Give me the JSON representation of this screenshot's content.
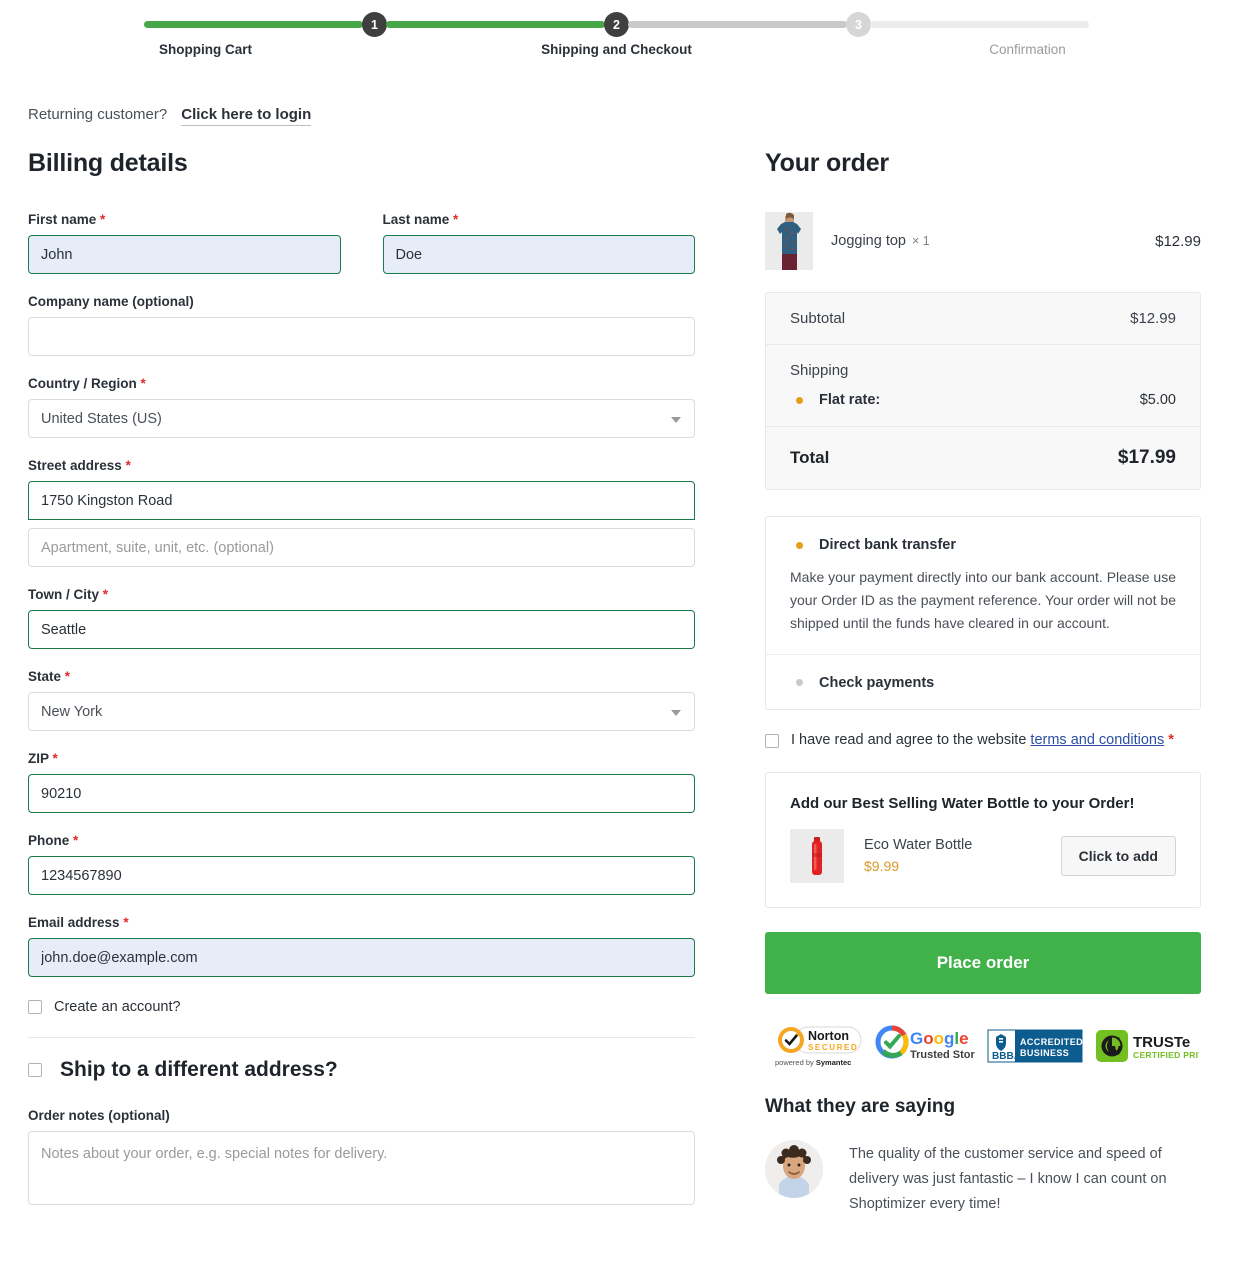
{
  "stepper": {
    "steps": [
      {
        "number": "1",
        "label": "Shopping Cart",
        "state": "active"
      },
      {
        "number": "2",
        "label": "Shipping and Checkout",
        "state": "active"
      },
      {
        "number": "3",
        "label": "Confirmation",
        "state": "inactive"
      }
    ]
  },
  "returning": {
    "prompt": "Returning customer?",
    "login_link": "Click here to login"
  },
  "billing": {
    "title": "Billing details",
    "first_name": {
      "label": "First name",
      "required": true,
      "value": "John"
    },
    "last_name": {
      "label": "Last name",
      "required": true,
      "value": "Doe"
    },
    "company": {
      "label": "Company name (optional)",
      "required": false,
      "value": ""
    },
    "country": {
      "label": "Country / Region",
      "required": true,
      "value": "United States (US)"
    },
    "street": {
      "label": "Street address",
      "required": true,
      "value": "1750 Kingston Road"
    },
    "apartment": {
      "placeholder": "Apartment, suite, unit, etc. (optional)",
      "value": ""
    },
    "city": {
      "label": "Town / City",
      "required": true,
      "value": "Seattle"
    },
    "state": {
      "label": "State",
      "required": true,
      "value": "New York"
    },
    "zip": {
      "label": "ZIP",
      "required": true,
      "value": "90210"
    },
    "phone": {
      "label": "Phone",
      "required": true,
      "value": "1234567890"
    },
    "email": {
      "label": "Email address",
      "required": true,
      "value": "john.doe@example.com"
    },
    "create_account": {
      "label": "Create an account?",
      "checked": false
    },
    "ship_different": {
      "label": "Ship to a different address?",
      "checked": false
    },
    "order_notes": {
      "label": "Order notes (optional)",
      "placeholder": "Notes about your order, e.g. special notes for delivery.",
      "value": ""
    }
  },
  "order": {
    "title": "Your order",
    "item": {
      "name": "Jogging top",
      "quantity": "× 1",
      "price": "$12.99"
    },
    "subtotal": {
      "label": "Subtotal",
      "amount": "$12.99"
    },
    "shipping": {
      "label": "Shipping",
      "option_label": "Flat rate:",
      "option_amount": "$5.00",
      "selected": true
    },
    "total": {
      "label": "Total",
      "amount": "$17.99"
    }
  },
  "payments": {
    "methods": [
      {
        "label": "Direct bank transfer",
        "selected": true,
        "description": "Make your payment directly into our bank account. Please use your Order ID as the payment reference. Your order will not be shipped until the funds have cleared in our account."
      },
      {
        "label": "Check payments",
        "selected": false,
        "description": ""
      }
    ],
    "terms": {
      "text_before": "I have read and agree to the website",
      "link": "terms and conditions",
      "required": true,
      "checked": false
    }
  },
  "upsell": {
    "title": "Add our Best Selling Water Bottle to your Order!",
    "product_name": "Eco Water Bottle",
    "product_price": "$9.99",
    "add_button": "Click to add"
  },
  "place_order_button": "Place order",
  "badges": [
    {
      "name": "norton-secured-badge",
      "title": "Norton",
      "subtitle": "SECURED",
      "footer": "powered by Symantec"
    },
    {
      "name": "google-trusted-store-badge",
      "title": "Google",
      "subtitle": "Trusted Store"
    },
    {
      "name": "bbb-accredited-business-badge",
      "title": "BBB",
      "subtitle": "ACCREDITED BUSINESS"
    },
    {
      "name": "truste-certified-privacy-badge",
      "title": "TRUSTe",
      "subtitle": "CERTIFIED PRIVACY"
    }
  ],
  "testimonial": {
    "title": "What they are saying",
    "quote": "The quality of the customer service and speed of delivery was just fantastic – I know I can count on Shoptimizer every time!"
  },
  "colors": {
    "progress_green": "#47a647",
    "place_order_green": "#41b14a",
    "required_red": "#e02b2b",
    "radio_amber": "#e2a01a",
    "link_blue": "#2b4ea2",
    "field_valid_border": "#1a7a4c",
    "autofill_bg": "#e6edf9"
  }
}
